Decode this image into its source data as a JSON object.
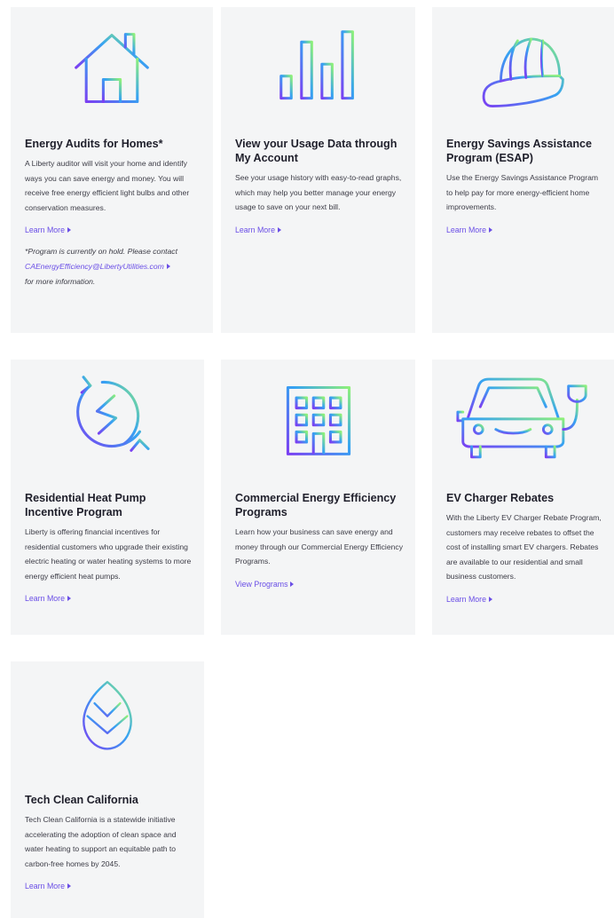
{
  "cards": [
    {
      "icon": "house-icon",
      "title": "Energy Audits for Homes*",
      "description": "A Liberty auditor will visit your home and identify ways you can save energy and money. You will receive free energy efficient light bulbs and other conservation measures.",
      "link": "Learn More",
      "note": {
        "text_before": "*Program is currently on hold. Please contact",
        "email": "CAEnergyEfficiency@LibertyUtilities.com",
        "text_after": "for more information."
      }
    },
    {
      "icon": "bar-chart-icon",
      "title": "View your Usage Data through My Account",
      "description": "See your usage history with easy-to-read graphs, which may help you better manage your energy usage to save on your next bill.",
      "link": "Learn More"
    },
    {
      "icon": "hard-hat-icon",
      "title": "Energy Savings Assistance Program (ESAP)",
      "description": "Use the Energy Savings Assistance Program to help pay for more energy-efficient home improvements.",
      "link": "Learn More"
    },
    {
      "icon": "heat-pump-cycle-icon",
      "title": "Residential Heat Pump Incentive Program",
      "description": "Liberty is offering financial incentives for residential customers who upgrade their existing electric heating or water heating systems to more energy efficient heat pumps.",
      "link": "Learn More"
    },
    {
      "icon": "office-building-icon",
      "title": "Commercial Energy Efficiency Programs",
      "description": "Learn how your business can save energy and money through our Commercial Energy Efficiency Programs.",
      "link": "View Programs"
    },
    {
      "icon": "electric-car-icon",
      "title": "EV Charger Rebates",
      "description": "With the Liberty EV Charger Rebate Program, customers may receive rebates to offset the cost of installing smart EV chargers. Rebates are available to our residential and small business customers.",
      "link": "Learn More"
    },
    {
      "icon": "leaf-icon",
      "title": "Tech Clean California",
      "description": "Tech Clean California is a statewide initiative accelerating the adoption of clean space and water heating to support an equitable path to carbon-free homes by 2045.",
      "link": "Learn More"
    }
  ],
  "colors": {
    "card_background": "#f4f5f6",
    "link": "#6a4ee6",
    "gradient_start": "#7b3ff2",
    "gradient_mid": "#3aa0f0",
    "gradient_end": "#8ef07a"
  }
}
